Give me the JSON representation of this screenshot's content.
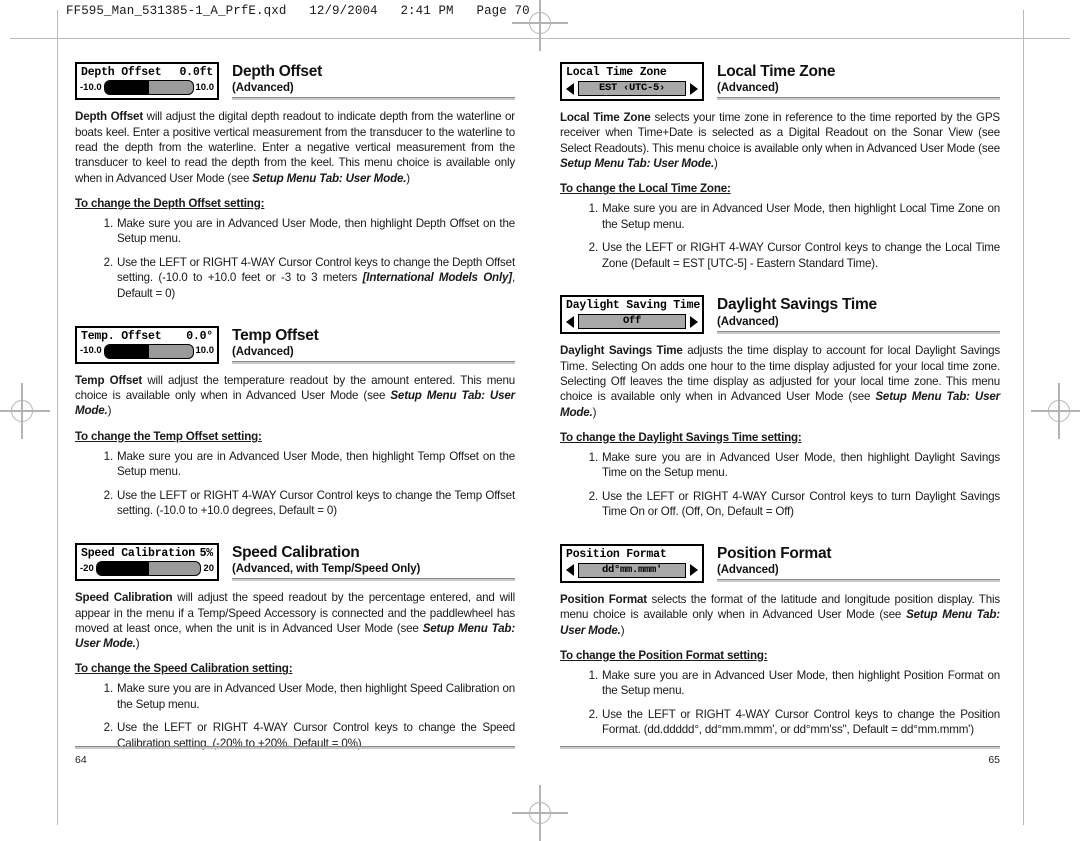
{
  "file_header": "FF595_Man_531385-1_A_PrfE.qxd   12/9/2004   2:41 PM   Page 70",
  "left_page": {
    "page_number": "64",
    "sections": [
      {
        "widget": {
          "type": "slider",
          "label": "Depth Offset",
          "value": "0.0ft",
          "min_label": "-10.0",
          "max_label": "10.0",
          "fill_percent": 50
        },
        "title": "Depth Offset",
        "subtitle": "(Advanced)",
        "body_lead": "Depth Offset",
        "body_rest": " will adjust the digital depth readout to indicate depth from the waterline or boats keel. Enter a positive vertical measurement from the transducer to the waterline to read the depth from the waterline. Enter a negative vertical measurement from the transducer to keel to read the depth from the keel. This menu choice is available only when in Advanced User Mode (see ",
        "body_italic": "Setup Menu Tab: User Mode.",
        "body_tail": ")",
        "steps_title": "To change the Depth Offset setting:",
        "steps": [
          {
            "text": "Make sure you are in Advanced User Mode, then highlight Depth Offset on the Setup menu."
          },
          {
            "text": "Use the LEFT or RIGHT 4-WAY Cursor Control keys to change the Depth Offset setting. (-10.0 to +10.0 feet or -3 to 3 meters ",
            "italic": "[International Models Only]",
            "tail": ", Default = 0)"
          }
        ]
      },
      {
        "widget": {
          "type": "slider",
          "label": "Temp. Offset",
          "value": "0.0°",
          "min_label": "-10.0",
          "max_label": "10.0",
          "fill_percent": 50
        },
        "title": "Temp Offset",
        "subtitle": "(Advanced)",
        "body_lead": "Temp Offset",
        "body_rest": " will adjust the temperature readout by the amount entered. This menu choice is available only when in Advanced User Mode (see ",
        "body_italic": "Setup Menu Tab: User Mode.",
        "body_tail": ")",
        "steps_title": "To change the Temp Offset setting:",
        "steps": [
          {
            "text": "Make sure you are in Advanced User Mode, then highlight Temp Offset on the Setup menu."
          },
          {
            "text": "Use the LEFT or RIGHT 4-WAY Cursor Control keys to change the Temp Offset setting. (-10.0 to +10.0 degrees, Default = 0)"
          }
        ]
      },
      {
        "widget": {
          "type": "slider",
          "label": "Speed Calibration",
          "value": "5%",
          "min_label": "-20",
          "max_label": "20",
          "fill_percent": 50
        },
        "title": "Speed Calibration",
        "subtitle": "(Advanced, with Temp/Speed Only)",
        "body_lead": "Speed Calibration",
        "body_rest": " will adjust the speed readout by the percentage entered, and will appear in the menu if a Temp/Speed Accessory is connected and the paddlewheel has moved at least once, when the unit is in Advanced User Mode (see ",
        "body_italic": "Setup Menu Tab: User Mode.",
        "body_tail": ")",
        "steps_title": "To change the Speed Calibration setting:",
        "steps": [
          {
            "text": "Make sure you are in Advanced User Mode, then highlight Speed Calibration on the Setup menu."
          },
          {
            "text": "Use the LEFT or RIGHT 4-WAY Cursor Control keys to change the Speed Calibration setting. (-20% to +20%, Default = 0%)"
          }
        ]
      }
    ]
  },
  "right_page": {
    "page_number": "65",
    "sections": [
      {
        "widget": {
          "type": "arrows",
          "label": "Local Time Zone",
          "value": "EST ‹UTC-5›"
        },
        "title": "Local Time Zone",
        "subtitle": "(Advanced)",
        "body_lead": "Local Time Zone",
        "body_rest": " selects your time zone in reference to the time reported by the GPS receiver when Time+Date is selected as a Digital Readout on the Sonar View (see Select Readouts).  This menu choice is available only when in Advanced User Mode (see ",
        "body_italic": "Setup Menu Tab: User Mode.",
        "body_tail": ")",
        "steps_title": "To change the Local Time Zone:",
        "steps": [
          {
            "text": "Make sure you are in Advanced User Mode, then highlight Local Time Zone on the Setup menu."
          },
          {
            "text": "Use the LEFT or RIGHT 4-WAY Cursor Control keys to change the Local Time Zone (Default = EST [UTC-5] - Eastern Standard Time)."
          }
        ]
      },
      {
        "widget": {
          "type": "arrows",
          "label": "Daylight Saving Time",
          "value": "Off"
        },
        "title": "Daylight Savings Time",
        "subtitle": "(Advanced)",
        "body_lead": "Daylight Savings Time",
        "body_rest": " adjusts the time display to account for local Daylight Savings Time. Selecting On adds one hour to the time display adjusted for your local time zone.  Selecting Off leaves the time display as adjusted for your local time zone. This menu choice is available only when in Advanced User Mode (see ",
        "body_italic": "Setup Menu Tab: User Mode.",
        "body_tail": ")",
        "steps_title": "To change the Daylight Savings Time setting:",
        "steps": [
          {
            "text": "Make sure you are in Advanced User Mode, then highlight Daylight Savings Time on the Setup menu."
          },
          {
            "text": "Use the LEFT or RIGHT 4-WAY Cursor Control keys to turn Daylight Savings Time On or Off. (Off, On, Default = Off)"
          }
        ]
      },
      {
        "widget": {
          "type": "arrows",
          "label": "Position Format",
          "value": "dd°mm.mmm'"
        },
        "title": "Position Format",
        "subtitle": "(Advanced)",
        "body_lead": "Position Format",
        "body_rest": " selects the format of the latitude and longitude position display.   This menu choice is available only when in Advanced User Mode (see ",
        "body_italic": "Setup Menu Tab: User Mode.",
        "body_tail": ")",
        "steps_title": "To change the Position Format setting:",
        "steps": [
          {
            "text": "Make sure you are in Advanced User Mode, then highlight Position Format on the Setup menu."
          },
          {
            "text": "Use the LEFT or RIGHT 4-WAY Cursor Control keys to change the Position Format. (dd.ddddd°, dd°mm.mmm', or dd°mm'ss\", Default = dd°mm.mmm')"
          }
        ]
      }
    ]
  }
}
